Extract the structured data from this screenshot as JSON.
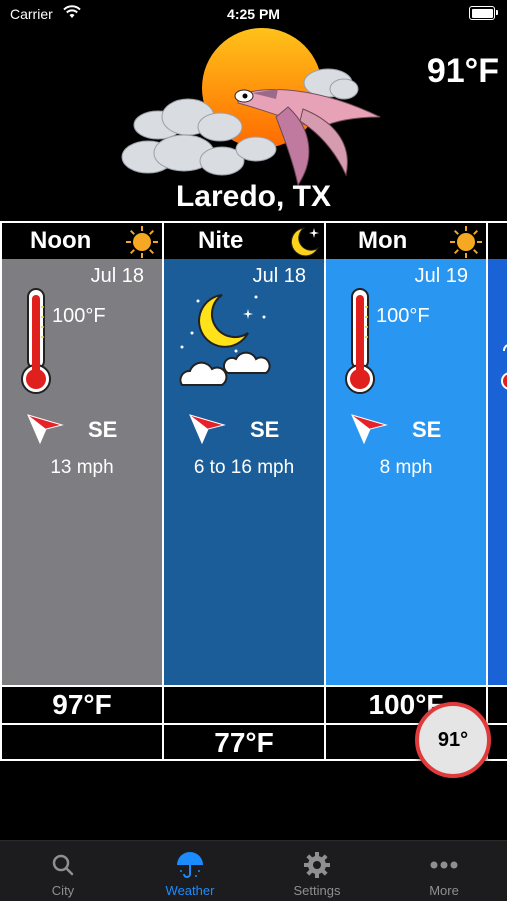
{
  "status_bar": {
    "carrier": "Carrier",
    "time": "4:25 PM"
  },
  "header": {
    "current_temp": "91°F",
    "city": "Laredo, TX"
  },
  "forecast": [
    {
      "title": "Noon",
      "badge": "sun-icon",
      "bg": "#7d7d82",
      "date": "Jul 18",
      "condition": "hot",
      "hi_label": "100°F",
      "wind_dir": "SE",
      "wind_speed": "13 mph",
      "hi": "97°F",
      "lo": ""
    },
    {
      "title": "Nite",
      "badge": "moon-icon",
      "bg": "#1b5d99",
      "date": "Jul 18",
      "condition": "clear-night",
      "hi_label": "",
      "wind_dir": "SE",
      "wind_speed": "6 to 16 mph",
      "hi": "",
      "lo": "77°F"
    },
    {
      "title": "Mon",
      "badge": "sun-icon",
      "bg": "#2997f2",
      "date": "Jul 19",
      "condition": "hot",
      "hi_label": "100°F",
      "wind_dir": "SE",
      "wind_speed": "8 mph",
      "hi": "100°F",
      "lo": ""
    },
    {
      "title": "",
      "badge": "",
      "bg": "#1a63d6",
      "date": "",
      "condition": "",
      "hi_label": "",
      "wind_dir": "",
      "wind_speed": "",
      "hi": "",
      "lo": ""
    }
  ],
  "bubble": {
    "temp": "91°"
  },
  "tabbar": {
    "tabs": [
      {
        "label": "City",
        "icon": "search-icon",
        "active": false
      },
      {
        "label": "Weather",
        "icon": "umbrella-icon",
        "active": true
      },
      {
        "label": "Settings",
        "icon": "gear-icon",
        "active": false
      },
      {
        "label": "More",
        "icon": "ellipsis-icon",
        "active": false
      }
    ]
  },
  "colors": {
    "accent": "#1a8cff",
    "bubble_ring": "#e03a3a",
    "tab_inactive": "#8e8e93"
  }
}
